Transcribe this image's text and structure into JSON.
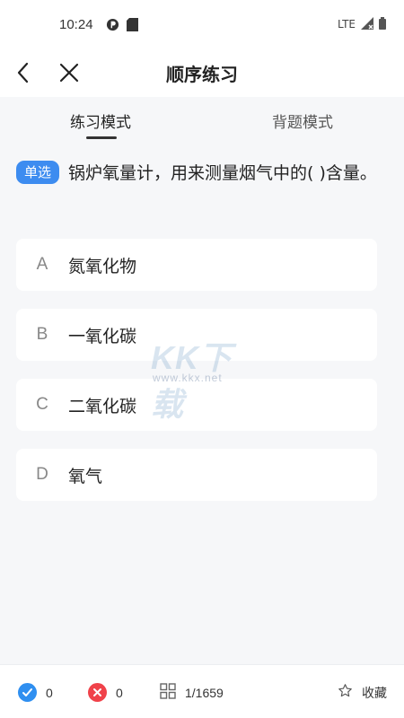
{
  "status_bar": {
    "time": "10:24",
    "network": "LTE"
  },
  "nav": {
    "title": "顺序练习"
  },
  "tabs": [
    {
      "label": "练习模式",
      "active": true
    },
    {
      "label": "背题模式",
      "active": false
    }
  ],
  "question": {
    "type_badge": "单选",
    "text": "锅炉氧量计，用来测量烟气中的( )含量。"
  },
  "options": [
    {
      "letter": "A",
      "text": "氮氧化物"
    },
    {
      "letter": "B",
      "text": "一氧化碳"
    },
    {
      "letter": "C",
      "text": "二氧化碳"
    },
    {
      "letter": "D",
      "text": "氧气"
    }
  ],
  "watermark": {
    "brand": "KK下载",
    "url": "www.kkx.net"
  },
  "bottom_bar": {
    "correct_count": "0",
    "wrong_count": "0",
    "progress": "1/1659",
    "favorite_label": "收藏"
  },
  "colors": {
    "accent": "#3d8cf0",
    "correct": "#2f8ff0",
    "wrong": "#f0424a"
  }
}
